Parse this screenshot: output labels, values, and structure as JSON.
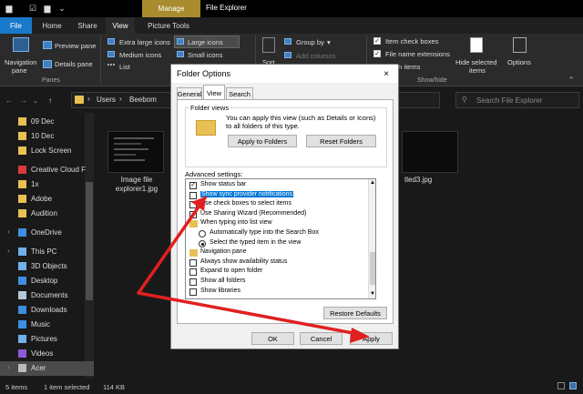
{
  "window": {
    "title": "File Explorer",
    "manage_tab": "Manage"
  },
  "tabs": [
    "File",
    "Home",
    "Share",
    "View",
    "Picture Tools"
  ],
  "ribbon": {
    "panes": {
      "navigation_pane": "Navigation",
      "navigation_pane2": "pane",
      "preview_pane": "Preview pane",
      "details_pane": "Details pane",
      "group": "Panes"
    },
    "layout": {
      "extra_large": "Extra large icons",
      "large": "Large icons",
      "medium": "Medium icons",
      "small": "Small icons",
      "list": "List"
    },
    "view": {
      "sort": "Sort",
      "group_by": "Group by",
      "add_columns": "Add columns"
    },
    "showhide": {
      "item_check_boxes": "Item check boxes",
      "file_name_ext": "File name extensions",
      "hidden_items": "en items",
      "hide_selected": "Hide selected",
      "hide_selected2": "items",
      "options": "Options",
      "group": "Show/hide"
    }
  },
  "address": {
    "crumbs": [
      "Users",
      "Beebom"
    ],
    "search_placeholder": "Search File Explorer"
  },
  "nav": [
    {
      "label": "09 Dec",
      "icon": "folder"
    },
    {
      "label": "10 Dec",
      "icon": "folder"
    },
    {
      "label": "Lock Screen",
      "icon": "folder"
    },
    {
      "label": "Creative Cloud F",
      "icon": "cloud"
    },
    {
      "label": "1x",
      "icon": "folder"
    },
    {
      "label": "Adobe",
      "icon": "folder"
    },
    {
      "label": "Audition",
      "icon": "folder"
    },
    {
      "label": "OneDrive",
      "icon": "onedrive"
    },
    {
      "label": "This PC",
      "icon": "pc"
    },
    {
      "label": "3D Objects",
      "icon": "3d"
    },
    {
      "label": "Desktop",
      "icon": "desktop"
    },
    {
      "label": "Documents",
      "icon": "documents"
    },
    {
      "label": "Downloads",
      "icon": "downloads"
    },
    {
      "label": "Music",
      "icon": "music"
    },
    {
      "label": "Pictures",
      "icon": "pictures"
    },
    {
      "label": "Videos",
      "icon": "videos"
    },
    {
      "label": "Acer",
      "icon": "drive"
    }
  ],
  "files": [
    {
      "name_line1": "Image file",
      "name_line2": "explorer1.jpg"
    },
    {
      "name_line1": "tled3.jpg",
      "name_line2": ""
    }
  ],
  "status": {
    "items": "5 items",
    "selected": "1 item selected",
    "size": "114 KB"
  },
  "dialog": {
    "title": "Folder Options",
    "close": "×",
    "tabs": [
      "General",
      "View",
      "Search"
    ],
    "folder_views_label": "Folder views",
    "folder_views_text": "You can apply this view (such as Details or Icons) to all folders of this type.",
    "apply_to_folders": "Apply to Folders",
    "reset_folders": "Reset Folders",
    "advanced_label": "Advanced settings:",
    "advanced": [
      {
        "type": "check",
        "checked": true,
        "label": "Show status bar"
      },
      {
        "type": "check",
        "checked": false,
        "label": "Show sync provider notifications",
        "highlight": true
      },
      {
        "type": "check",
        "checked": false,
        "label": "Use check boxes to select items"
      },
      {
        "type": "check",
        "checked": true,
        "label": "Use Sharing Wizard (Recommended)"
      },
      {
        "type": "folder",
        "label": "When typing into list view"
      },
      {
        "type": "radio",
        "checked": false,
        "label": "Automatically type into the Search Box",
        "indent": true
      },
      {
        "type": "radio",
        "checked": true,
        "label": "Select the typed item in the view",
        "indent": true
      },
      {
        "type": "folder",
        "label": "Navigation pane"
      },
      {
        "type": "check",
        "checked": false,
        "label": "Always show availability status"
      },
      {
        "type": "check",
        "checked": false,
        "label": "Expand to open folder"
      },
      {
        "type": "check",
        "checked": false,
        "label": "Show all folders"
      },
      {
        "type": "check",
        "checked": false,
        "label": "Show libraries"
      }
    ],
    "restore_defaults": "Restore Defaults",
    "ok": "OK",
    "cancel": "Cancel",
    "apply": "Apply"
  },
  "colors": {
    "accent": "#1979ca",
    "arrow": "#e02020",
    "highlight": "#0078d7"
  }
}
